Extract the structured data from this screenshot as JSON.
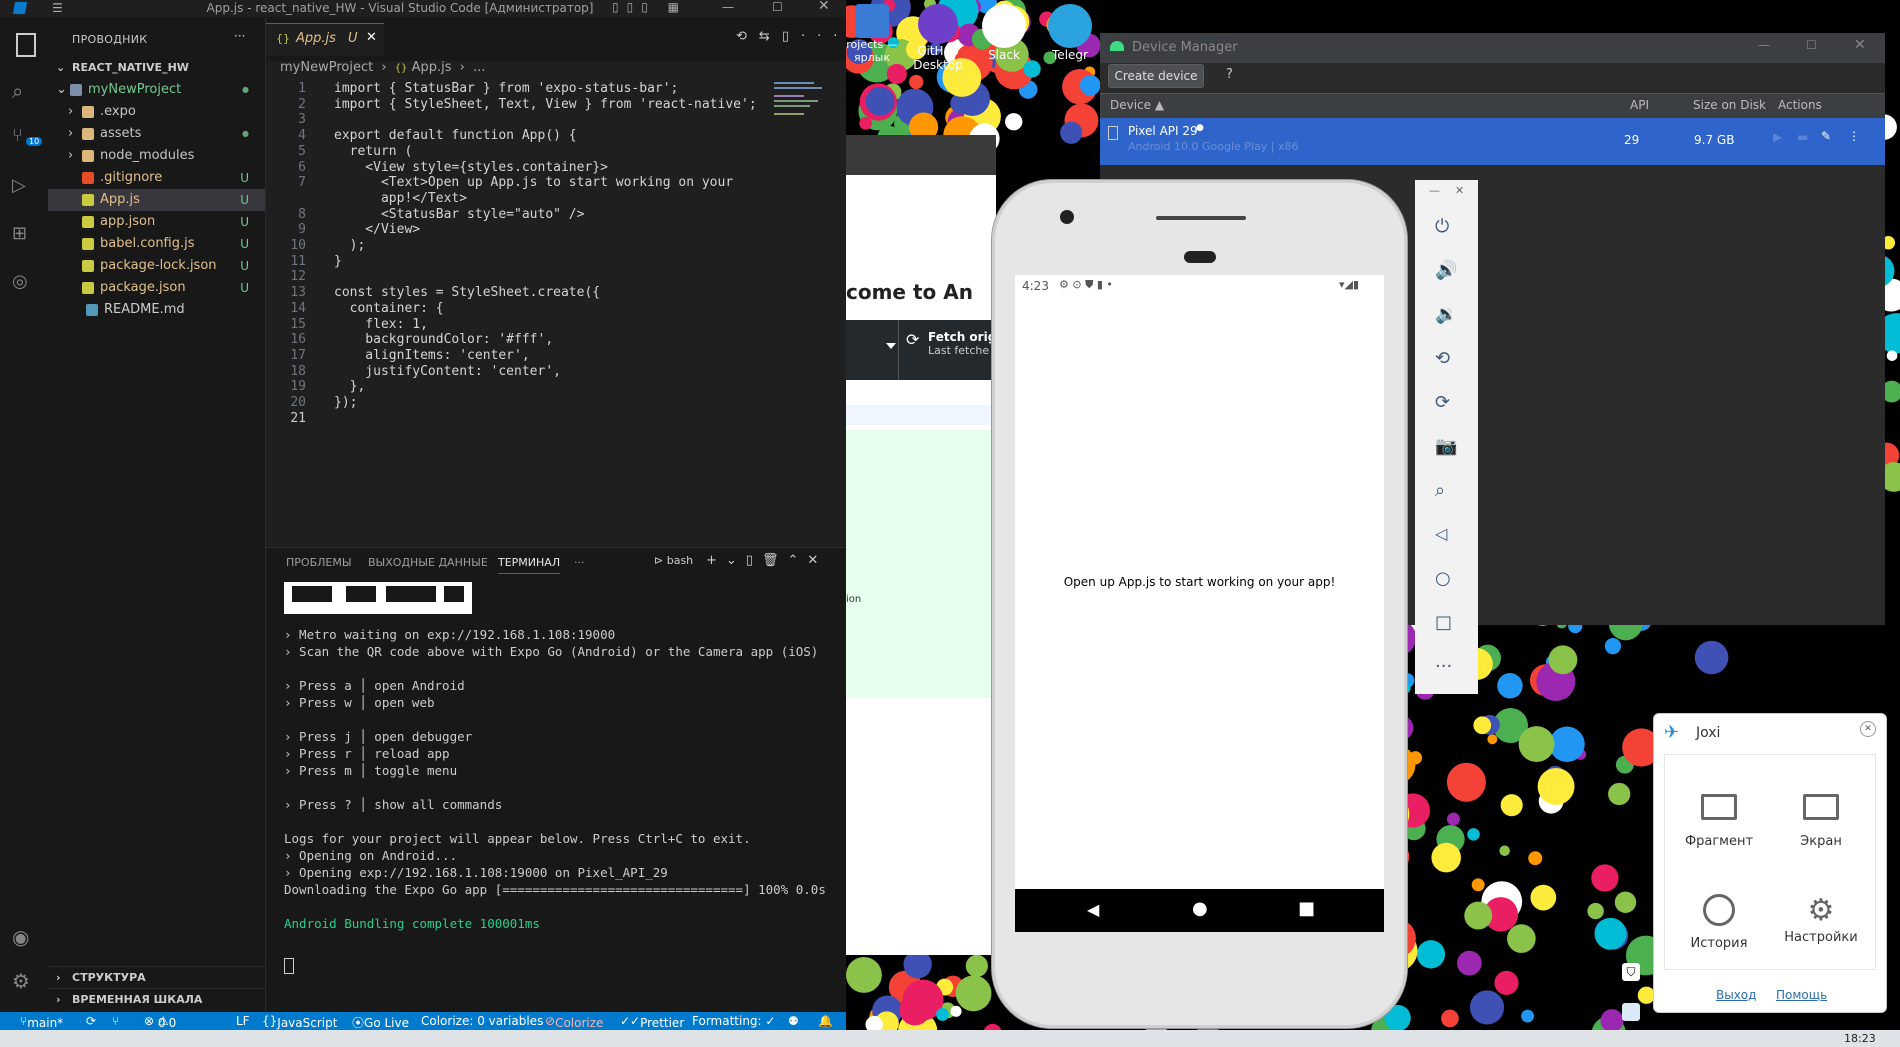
{
  "vscode": {
    "window_title": "App.js - react_native_HW - Visual Studio Code [Администратор]",
    "explorer_title": "ПРОВОДНИК",
    "root_folder": "REACT_NATIVE_HW",
    "tree": [
      {
        "name": "myNewProject",
        "badge": "●",
        "kind": "folder-open"
      },
      {
        "name": ".expo",
        "badge": "",
        "kind": "folder"
      },
      {
        "name": "assets",
        "badge": "●",
        "kind": "folder"
      },
      {
        "name": "node_modules",
        "badge": "",
        "kind": "folder"
      },
      {
        "name": ".gitignore",
        "badge": "U",
        "kind": "git"
      },
      {
        "name": "App.js",
        "badge": "U",
        "kind": "js"
      },
      {
        "name": "app.json",
        "badge": "U",
        "kind": "json"
      },
      {
        "name": "babel.config.js",
        "badge": "U",
        "kind": "js"
      },
      {
        "name": "package-lock.json",
        "badge": "U",
        "kind": "json"
      },
      {
        "name": "package.json",
        "badge": "U",
        "kind": "json"
      },
      {
        "name": "README.md",
        "badge": "",
        "kind": "md"
      }
    ],
    "outline_label": "СТРУКТУРА",
    "timeline_label": "ВРЕМЕННАЯ ШКАЛА",
    "tab_name": "App.js",
    "tab_badge": "U",
    "breadcrumb": [
      "myNewProject",
      "App.js",
      "..."
    ],
    "panel_tabs": [
      "ПРОБЛЕМЫ",
      "ВЫХОДНЫЕ ДАННЫЕ",
      "ТЕРМИНАЛ"
    ],
    "terminal_shell": "bash",
    "terminal_lines": [
      "› Metro waiting on exp://192.168.1.108:19000",
      "› Scan the QR code above with Expo Go (Android) or the Camera app (iOS)",
      "",
      "› Press a │ open Android",
      "› Press w │ open web",
      "",
      "› Press j │ open debugger",
      "› Press r │ reload app",
      "› Press m │ toggle menu",
      "",
      "› Press ? │ show all commands",
      "",
      "Logs for your project will appear below. Press Ctrl+C to exit.",
      "› Opening on Android...",
      "› Opening exp://192.168.1.108:19000 on Pixel_API_29",
      "Downloading the Expo Go app [================================] 100% 0.0s",
      "",
      "Android Bundling complete 100001ms"
    ],
    "status": {
      "branch": "main*",
      "errors": "0",
      "warnings": "0",
      "eol": "LF",
      "language": "JavaScript",
      "golive": "Go Live",
      "colorize_vars": "Colorize: 0 variables",
      "colorize": "Colorize",
      "prettier": "Prettier",
      "formatting": "Formatting: ✓"
    }
  },
  "code_lines": [
    "import { StatusBar } from 'expo-status-bar';",
    "import { StyleSheet, Text, View } from 'react-native';",
    "",
    "export default function App() {",
    "  return (",
    "    <View style={styles.container}>",
    "      <Text>Open up App.js to start working on your",
    "      app!</Text>",
    "      <StatusBar style=\"auto\" />",
    "    </View>",
    "  );",
    "}",
    "",
    "const styles = StyleSheet.create({",
    "  container: {",
    "    flex: 1,",
    "    backgroundColor: '#fff',",
    "    alignItems: 'center',",
    "    justifyContent: 'center',",
    "  },",
    "});",
    ""
  ],
  "line_numbers": [
    "1",
    "2",
    "3",
    "4",
    "5",
    "6",
    "7",
    "",
    "8",
    "9",
    "10",
    "11",
    "12",
    "13",
    "14",
    "15",
    "16",
    "17",
    "18",
    "19",
    "20",
    "21"
  ],
  "device_manager": {
    "title": "Device Manager",
    "create_button": "Create device",
    "help": "?",
    "col_device": "Device",
    "col_api": "API",
    "col_size": "Size on Disk",
    "col_actions": "Actions",
    "device_name": "Pixel API 29",
    "device_sub": "Android 10.0 Google Play | x86",
    "device_api": "29",
    "device_size": "9.7 GB"
  },
  "emulator": {
    "time": "4:23",
    "app_text": "Open up App.js to start working on your app!"
  },
  "desktop_icons": [
    {
      "label": "rojects —\nярлык"
    },
    {
      "label": "GitHub\nDesktop"
    },
    {
      "label": "Slack"
    },
    {
      "label": "Telegr"
    }
  ],
  "bg_window": {
    "heading": "come to An",
    "fetch": "Fetch orig",
    "fetch_sub": "Last fetche",
    "ion": "ion"
  },
  "joxi": {
    "title": "Joxi",
    "fragment": "Фрагмент",
    "screen": "Экран",
    "history": "История",
    "settings": "Настройки",
    "logout": "Выход",
    "help": "Помощь"
  },
  "clock": "18:23"
}
